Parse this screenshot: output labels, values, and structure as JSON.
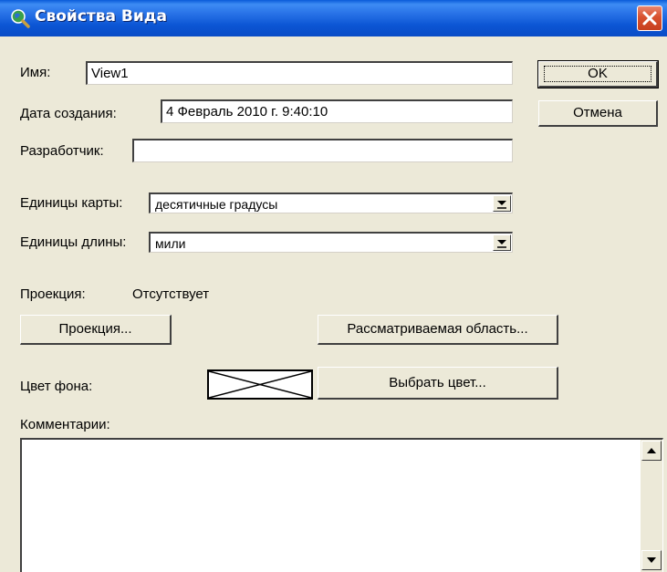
{
  "window": {
    "title": "Свойства Вида",
    "title_icon": "magnifier-globe-icon",
    "close_icon": "close-icon",
    "titlebar_color": "#0a5bd8",
    "close_color": "#d8512f"
  },
  "fields": {
    "name": {
      "label": "Имя:",
      "value": "View1"
    },
    "created": {
      "label": "Дата создания:",
      "value": "4 Февраль 2010 г. 9:40:10"
    },
    "developer": {
      "label": "Разработчик:",
      "value": ""
    }
  },
  "units": {
    "map_label": "Единицы карты:",
    "map_value": "десятичные градусы",
    "length_label": "Единицы длины:",
    "length_value": "мили"
  },
  "projection": {
    "label": "Проекция:",
    "value": "Отсутствует",
    "button": "Проекция...",
    "extent_button": "Рассматриваемая область..."
  },
  "background": {
    "label": "Цвет фона:",
    "swatch": "no-color-icon",
    "choose_button": "Выбрать цвет..."
  },
  "comments": {
    "label": "Комментарии:",
    "value": ""
  },
  "buttons": {
    "ok": "OK",
    "cancel": "Отмена"
  },
  "colors": {
    "dialog_bg": "#ece9d8"
  }
}
